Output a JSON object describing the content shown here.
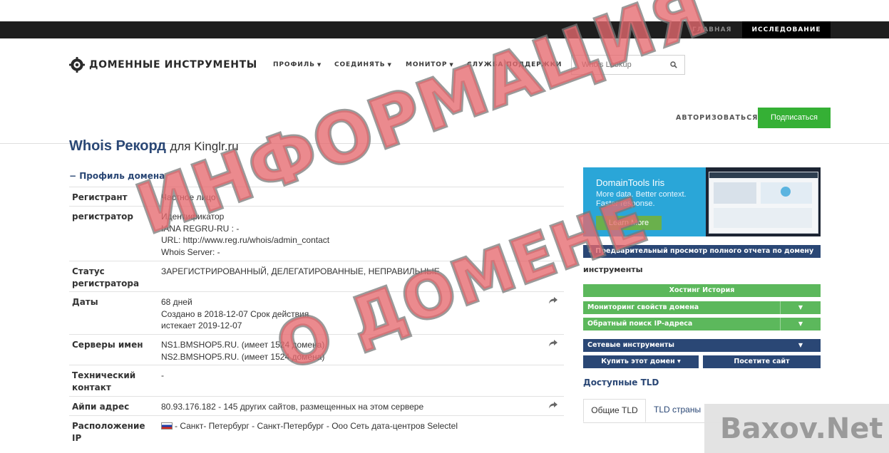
{
  "topbar": {
    "home": "ГЛАВНАЯ",
    "research": "ИССЛЕДОВАНИЕ"
  },
  "header": {
    "brand": "ДОМЕННЫЕ ИНСТРУМЕНТЫ",
    "nav": [
      "ПРОФИЛЬ",
      "СОЕДИНЯТЬ",
      "МОНИТОР",
      "СЛУЖБА ПОДДЕРЖКИ"
    ],
    "search_placeholder": "Whois Lookup",
    "login": "АВТОРИЗОВАТЬСЯ",
    "subscribe": "Подписаться"
  },
  "page": {
    "title_main": "Whois Рекорд",
    "title_sub": "для Kinglr.ru",
    "profile_toggle": "− Профиль домена"
  },
  "rows": [
    {
      "label": "Регистрант",
      "lines": [
        "Частное лицо"
      ]
    },
    {
      "label": "регистратор",
      "lines": [
        "Идентификатор",
        "IANA REGRU-RU : -",
        "URL: http://www.reg.ru/whois/admin_contact",
        "Whois Server: -"
      ]
    },
    {
      "label": "Статус регистратора",
      "lines": [
        "ЗАРЕГИСТРИРОВАННЫЙ, ДЕЛЕГАТИРОВАННЫЕ, НЕПРАВИЛЬНЫЕ"
      ]
    },
    {
      "label": "Даты",
      "lines": [
        "68 дней",
        "Создано в 2018-12-07 Срок действия",
        "истекает 2019-12-07"
      ]
    },
    {
      "label": "Серверы имен",
      "lines": [
        "NS1.BMSHOP5.RU. (имеет 1524 домена)",
        "NS2.BMSHOP5.RU. (имеет 1524 домена)"
      ]
    },
    {
      "label": "Технический контакт",
      "lines": [
        "-"
      ]
    },
    {
      "label": "Айпи адрес",
      "lines": [
        "80.93.176.182 - 145 других сайтов, размещенных на этом сервере"
      ]
    },
    {
      "label": "Расположение IP",
      "lines": [
        "- Санкт- Петербург - Санкт-Петербург - Ооо Сеть дата-центров Selectel"
      ]
    }
  ],
  "sidebar": {
    "promo_title": "DomainTools Iris",
    "promo_sub": "More data. Better context. Faster response.",
    "promo_btn": "Learn More",
    "full_report": "⬇ Предварительный просмотр полного отчета по домену",
    "tools_heading": "инструменты",
    "hosting_history": "Хостинг История",
    "monitor_props": "Мониторинг свойств домена",
    "reverse_ip": "Обратный поиск IP-адреса",
    "net_tools": "Сетевые инструменты",
    "buy_domain": "Купить этот домен ▾",
    "visit_site": "Посетите сайт",
    "tld_heading": "Доступные TLD",
    "tab_general": "Общие TLD",
    "tab_country": "TLD страны"
  },
  "watermark": {
    "line1": "ИНФОРМАЦИЯ",
    "line2": "О ДОМЕНЕ",
    "brand": "Baxov.Net"
  }
}
